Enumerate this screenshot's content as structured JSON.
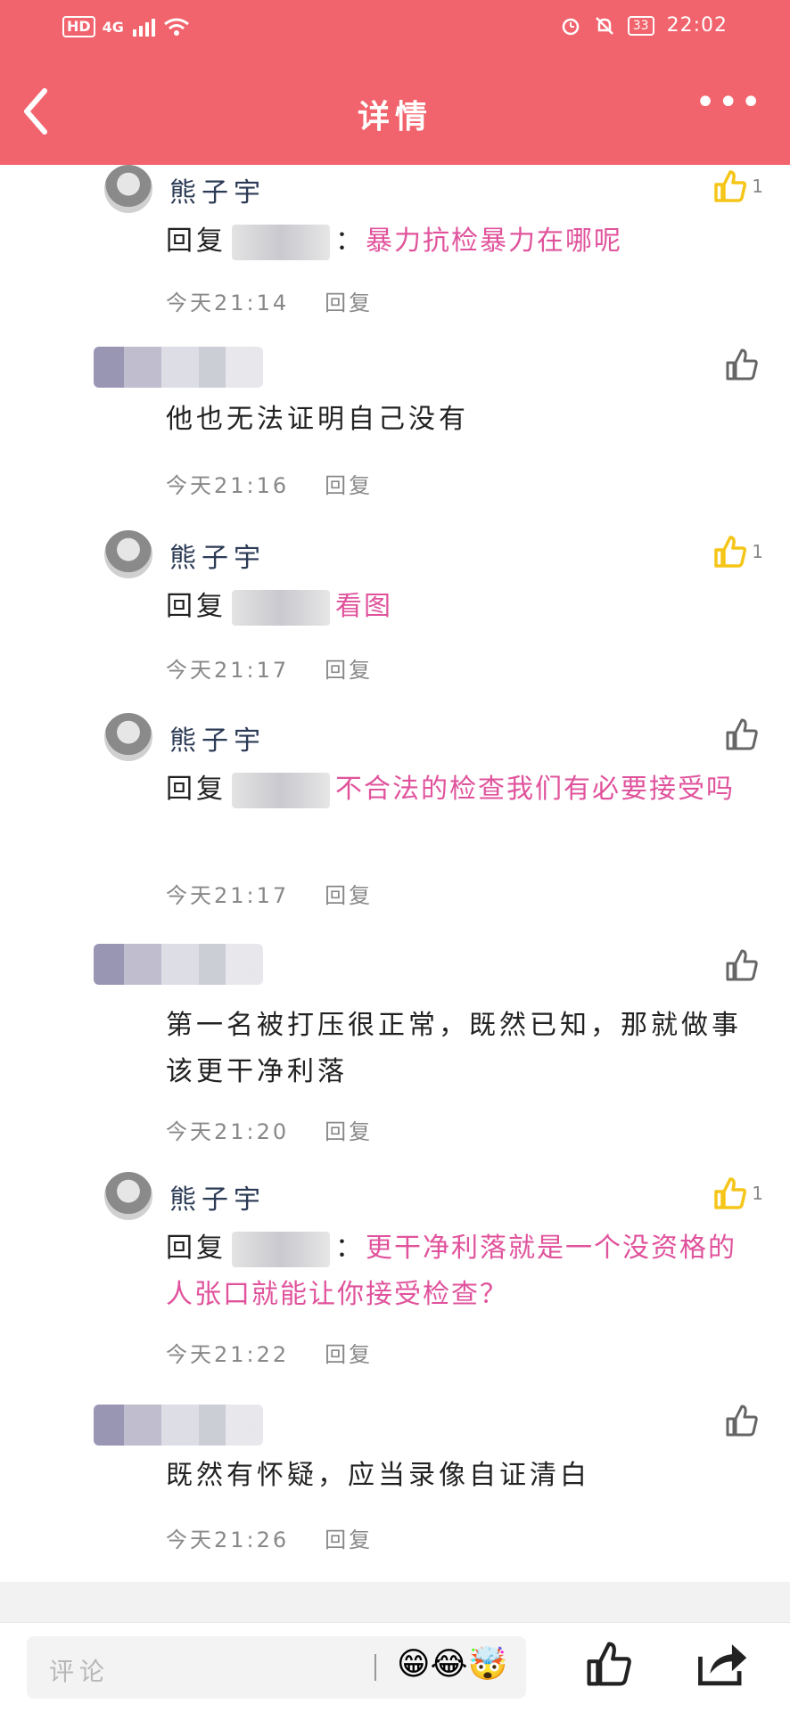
{
  "status_bar": {
    "left_badge": "HD",
    "network": "4G",
    "right_battery": "33",
    "time": "22:02"
  },
  "nav": {
    "title": "详情"
  },
  "comments": [
    {
      "name": "熊子宇",
      "reply_prefix": "回复",
      "separator": "：",
      "text": "暴力抗检暴力在哪呢",
      "time": "今天21:14",
      "reply_label": "回复",
      "likes": "1"
    },
    {
      "name": "",
      "reply_prefix": "",
      "separator": "",
      "text": "他也无法证明自己没有",
      "time": "今天21:16",
      "reply_label": "回复",
      "likes": ""
    },
    {
      "name": "熊子宇",
      "reply_prefix": "回复",
      "separator": "",
      "text": "看图",
      "time": "今天21:17",
      "reply_label": "回复",
      "likes": "1"
    },
    {
      "name": "熊子宇",
      "reply_prefix": "回复",
      "separator": "",
      "text": "不合法的检查我们有必要接受吗",
      "time": "今天21:17",
      "reply_label": "回复",
      "likes": ""
    },
    {
      "name": "",
      "reply_prefix": "",
      "separator": "",
      "text": "第一名被打压很正常，既然已知，那就做事该更干净利落",
      "time": "今天21:20",
      "reply_label": "回复",
      "likes": ""
    },
    {
      "name": "熊子宇",
      "reply_prefix": "回复",
      "separator": "：",
      "text": "更干净利落就是一个没资格的人张口就能让你接受检查？",
      "time": "今天21:22",
      "reply_label": "回复",
      "likes": "1"
    },
    {
      "name": "",
      "reply_prefix": "",
      "separator": "",
      "text": "既然有怀疑，应当录像自证清白",
      "time": "今天21:26",
      "reply_label": "回复",
      "likes": ""
    }
  ],
  "bottom": {
    "placeholder": "评论",
    "emoji": "😁😂🤯"
  },
  "colors": {
    "header": "#f2646d",
    "pink_text": "#e0539c",
    "like_active": "#f5c518"
  }
}
